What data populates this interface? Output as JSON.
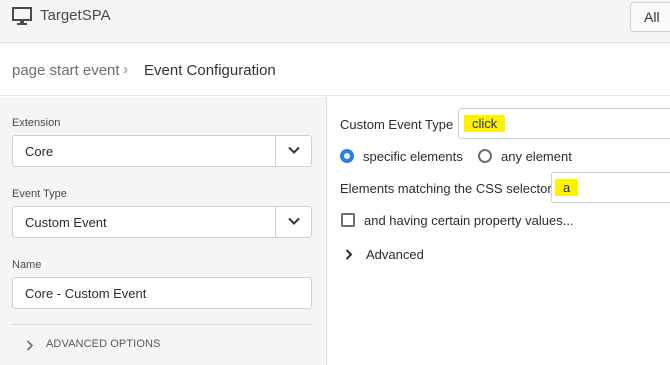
{
  "header": {
    "app_icon": "monitor-icon",
    "title": "TargetSPA",
    "all_button": "All"
  },
  "breadcrumb": {
    "parent": "page start event",
    "separator": "›",
    "current": "Event Configuration"
  },
  "left_panel": {
    "extension": {
      "label": "Extension",
      "value": "Core"
    },
    "event_type": {
      "label": "Event Type",
      "value": "Custom Event"
    },
    "name": {
      "label": "Name",
      "value": "Core - Custom Event"
    },
    "advanced_options": "ADVANCED OPTIONS"
  },
  "right_panel": {
    "custom_event_type": {
      "label": "Custom Event Type",
      "value": "click"
    },
    "radio_specific": {
      "label": "specific elements",
      "selected": true
    },
    "radio_any": {
      "label": "any element",
      "selected": false
    },
    "css_selector": {
      "label": "Elements matching the CSS selector",
      "value": "a"
    },
    "property_values": {
      "label": "and having certain property values...",
      "checked": false
    },
    "advanced": "Advanced"
  },
  "colors": {
    "accent": "#2680eb",
    "highlight": "#fff200",
    "panel_bg": "#f5f5f5"
  }
}
